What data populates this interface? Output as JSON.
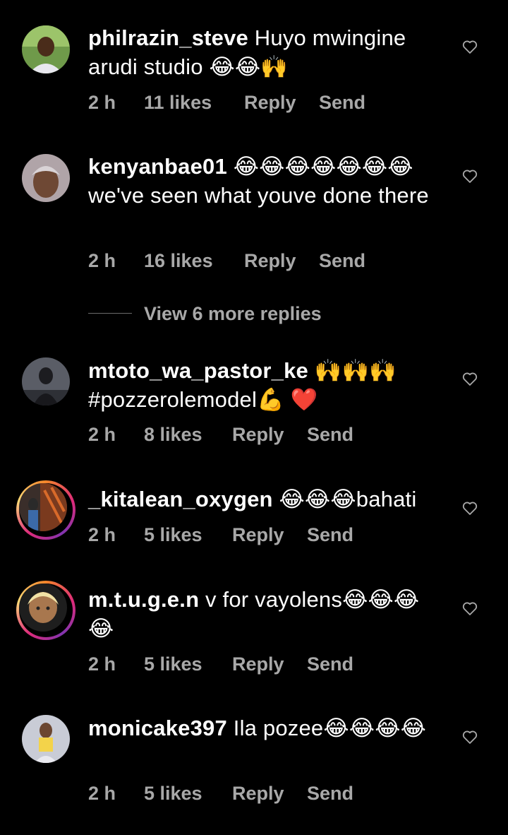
{
  "comments": [
    {
      "username": "philrazin_steve",
      "text": " Huyo mwingine arudi studio 😂😂🙌",
      "time": "2 h",
      "likes": "11 likes",
      "reply": "Reply",
      "send": "Send",
      "avatar": "avatar-photo",
      "story_ring": false
    },
    {
      "username": "kenyanbae01",
      "text": " 😂😂😂😂😂😂😂we've seen what youve done there",
      "time": "2 h",
      "likes": "16 likes",
      "reply": "Reply",
      "send": "Send",
      "avatar": "avatar-photo",
      "story_ring": false
    },
    {
      "username": "mtoto_wa_pastor_ke",
      "text": " 🙌🙌🙌 #pozzerolemodel💪 ❤️",
      "time": "2 h",
      "likes": "8 likes",
      "reply": "Reply",
      "send": "Send",
      "avatar": "avatar-photo",
      "story_ring": false
    },
    {
      "username": "_kitalean_oxygen",
      "text": " 😂😂😂bahati",
      "time": "2 h",
      "likes": "5 likes",
      "reply": "Reply",
      "send": "Send",
      "avatar": "avatar-photo",
      "story_ring": true
    },
    {
      "username": "m.t.u.g.e.n",
      "text": " v for vayolens😂😂😂😂",
      "time": "2 h",
      "likes": "5 likes",
      "reply": "Reply",
      "send": "Send",
      "avatar": "avatar-photo",
      "story_ring": true
    },
    {
      "username": "monicake397",
      "text": " Ila pozee😂😂😂😂",
      "time": "2 h",
      "likes": "5 likes",
      "reply": "Reply",
      "send": "Send",
      "avatar": "avatar-photo",
      "story_ring": false
    }
  ],
  "view_more_replies": "View 6 more replies",
  "icons": {
    "like": "heart-outline-icon"
  },
  "colors": {
    "background": "#000000",
    "text": "#ffffff",
    "meta": "#a8a8a8",
    "story_ring": [
      "#f58529",
      "#dd2a7b",
      "#8134af"
    ]
  }
}
